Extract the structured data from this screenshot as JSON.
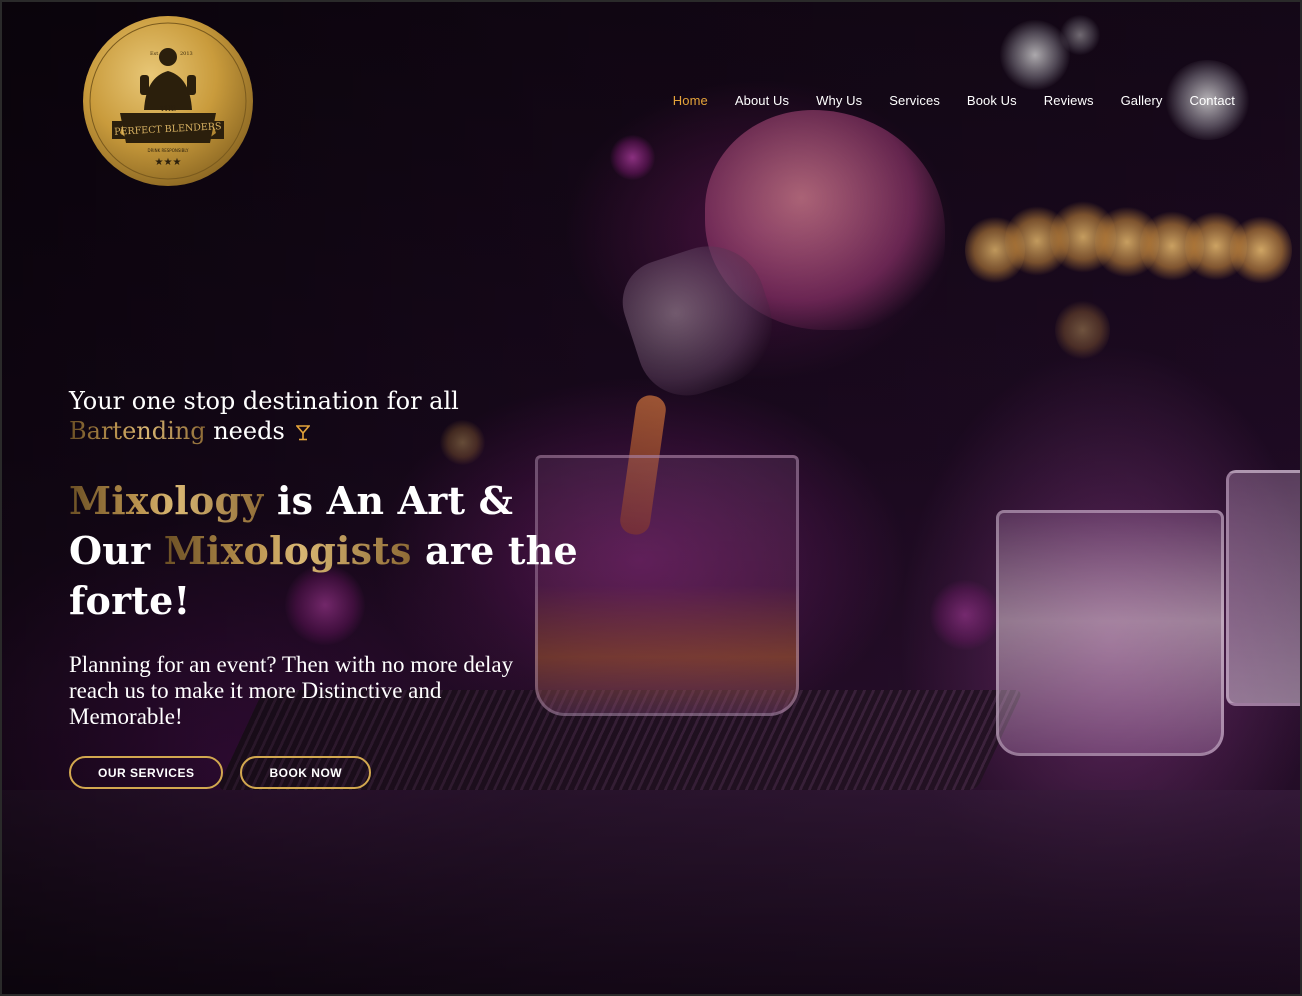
{
  "logo": {
    "top_text": "Est",
    "year": "2013",
    "small": "THE",
    "name": "PERFECT BLENDERS",
    "motto": "DRINK RESPONSIBLY"
  },
  "nav": {
    "items": [
      {
        "label": "Home",
        "active": true
      },
      {
        "label": "About Us",
        "active": false
      },
      {
        "label": "Why Us",
        "active": false
      },
      {
        "label": "Services",
        "active": false
      },
      {
        "label": "Book Us",
        "active": false
      },
      {
        "label": "Reviews",
        "active": false
      },
      {
        "label": "Gallery",
        "active": false
      },
      {
        "label": "Contact",
        "active": false
      }
    ]
  },
  "hero": {
    "tagline_line1": "Your one stop destination for all",
    "tagline_highlight": "Bartending",
    "tagline_end": " needs",
    "tagline_icon": "cocktail-glass-icon",
    "headline": {
      "word1": "Mixology",
      "part2": " is An Art &",
      "part3": "Our ",
      "word2": "Mixologists",
      "part4": " are the",
      "part5": "forte!"
    },
    "subtext": "Planning for an event? Then with no more delay reach us to make it more Distinctive and Memorable!",
    "buttons": {
      "services": "OUR SERVICES",
      "book": "BOOK NOW"
    }
  },
  "colors": {
    "accent": "#e5a43a",
    "button_border": "#d2a84f",
    "gold_text": "#b9924e"
  }
}
